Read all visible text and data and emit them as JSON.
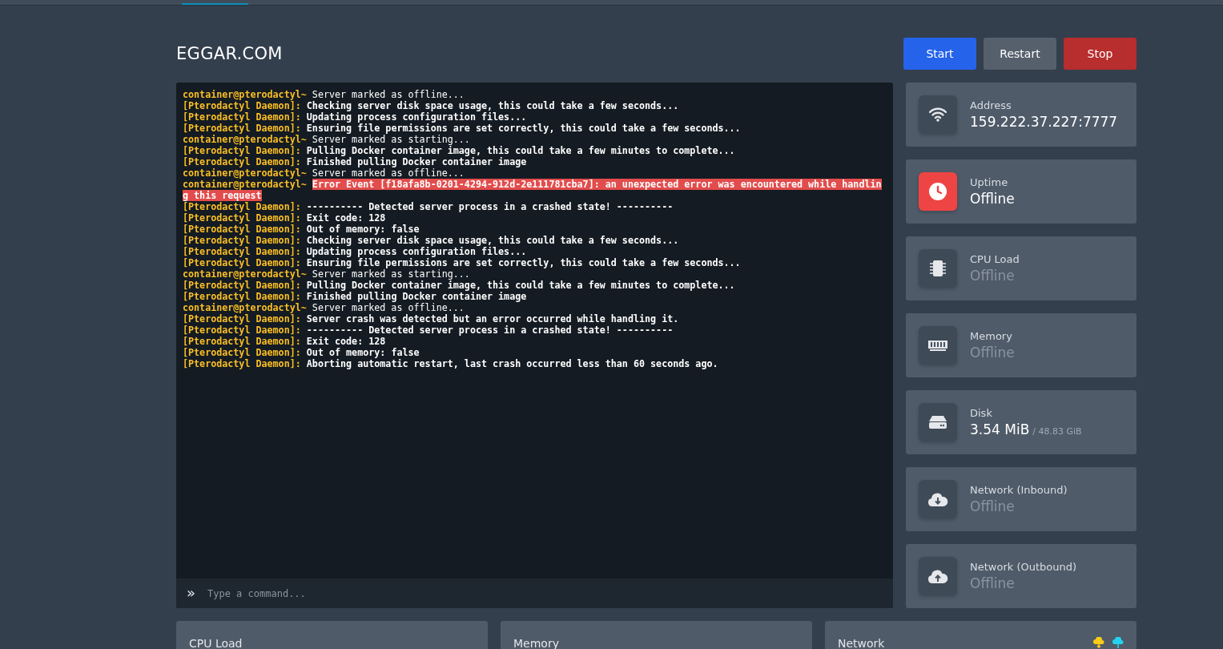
{
  "server": {
    "name": "EGGAR.COM"
  },
  "power_buttons": [
    {
      "label": "Start",
      "kind": "start"
    },
    {
      "label": "Restart",
      "kind": "restart"
    },
    {
      "label": "Stop",
      "kind": "stop"
    }
  ],
  "console": {
    "lines": [
      {
        "kind": "prompt",
        "prefix": "container@pterodactyl~",
        "text": "Server marked as offline..."
      },
      {
        "kind": "daemon",
        "prefix": "[Pterodactyl Daemon]:",
        "text": "Checking server disk space usage, this could take a few seconds..."
      },
      {
        "kind": "daemon",
        "prefix": "[Pterodactyl Daemon]:",
        "text": "Updating process configuration files..."
      },
      {
        "kind": "daemon",
        "prefix": "[Pterodactyl Daemon]:",
        "text": "Ensuring file permissions are set correctly, this could take a few seconds..."
      },
      {
        "kind": "prompt",
        "prefix": "container@pterodactyl~",
        "text": "Server marked as starting..."
      },
      {
        "kind": "daemon",
        "prefix": "[Pterodactyl Daemon]:",
        "text": "Pulling Docker container image, this could take a few minutes to complete..."
      },
      {
        "kind": "daemon",
        "prefix": "[Pterodactyl Daemon]:",
        "text": "Finished pulling Docker container image"
      },
      {
        "kind": "prompt",
        "prefix": "container@pterodactyl~",
        "text": "Server marked as offline..."
      },
      {
        "kind": "error",
        "prefix": "container@pterodactyl~",
        "text": "Error Event [f18afa8b-0201-4294-912d-2e111781cba7]: an unexpected error was encountered while handling this request"
      },
      {
        "kind": "daemon",
        "prefix": "[Pterodactyl Daemon]:",
        "text": "---------- Detected server process in a crashed state! ----------"
      },
      {
        "kind": "daemon",
        "prefix": "[Pterodactyl Daemon]:",
        "text": "Exit code: 128"
      },
      {
        "kind": "daemon",
        "prefix": "[Pterodactyl Daemon]:",
        "text": "Out of memory: false"
      },
      {
        "kind": "daemon",
        "prefix": "[Pterodactyl Daemon]:",
        "text": "Checking server disk space usage, this could take a few seconds..."
      },
      {
        "kind": "daemon",
        "prefix": "[Pterodactyl Daemon]:",
        "text": "Updating process configuration files..."
      },
      {
        "kind": "daemon",
        "prefix": "[Pterodactyl Daemon]:",
        "text": "Ensuring file permissions are set correctly, this could take a few seconds..."
      },
      {
        "kind": "prompt",
        "prefix": "container@pterodactyl~",
        "text": "Server marked as starting..."
      },
      {
        "kind": "daemon",
        "prefix": "[Pterodactyl Daemon]:",
        "text": "Pulling Docker container image, this could take a few minutes to complete..."
      },
      {
        "kind": "daemon",
        "prefix": "[Pterodactyl Daemon]:",
        "text": "Finished pulling Docker container image"
      },
      {
        "kind": "prompt",
        "prefix": "container@pterodactyl~",
        "text": "Server marked as offline..."
      },
      {
        "kind": "daemon",
        "prefix": "[Pterodactyl Daemon]:",
        "text": "Server crash was detected but an error occurred while handling it."
      },
      {
        "kind": "daemon",
        "prefix": "[Pterodactyl Daemon]:",
        "text": "---------- Detected server process in a crashed state! ----------"
      },
      {
        "kind": "daemon",
        "prefix": "[Pterodactyl Daemon]:",
        "text": "Exit code: 128"
      },
      {
        "kind": "daemon",
        "prefix": "[Pterodactyl Daemon]:",
        "text": "Out of memory: false"
      },
      {
        "kind": "daemon",
        "prefix": "[Pterodactyl Daemon]:",
        "text": "Aborting automatic restart, last crash occurred less than 60 seconds ago."
      }
    ],
    "prompt_symbol": "»",
    "placeholder": "Type a command..."
  },
  "stats": [
    {
      "kind": "address",
      "label": "Address",
      "value": "159.222.37.227:7777",
      "dimmed": false,
      "alert": false
    },
    {
      "kind": "uptime",
      "label": "Uptime",
      "value": "Offline",
      "dimmed": false,
      "alert": true
    },
    {
      "kind": "cpu",
      "label": "CPU Load",
      "value": "Offline",
      "dimmed": true,
      "alert": false
    },
    {
      "kind": "memory",
      "label": "Memory",
      "value": "Offline",
      "dimmed": true,
      "alert": false
    },
    {
      "kind": "disk",
      "label": "Disk",
      "value": "3.54 MiB",
      "limit": "/ 48.83 GiB",
      "dimmed": false,
      "alert": false
    },
    {
      "kind": "inbound",
      "label": "Network (Inbound)",
      "value": "Offline",
      "dimmed": true,
      "alert": false
    },
    {
      "kind": "outbound",
      "label": "Network (Outbound)",
      "value": "Offline",
      "dimmed": true,
      "alert": false
    }
  ],
  "graphs": [
    {
      "title": "CPU Load",
      "legend": false
    },
    {
      "title": "Memory",
      "legend": false
    },
    {
      "title": "Network",
      "legend": true
    }
  ]
}
